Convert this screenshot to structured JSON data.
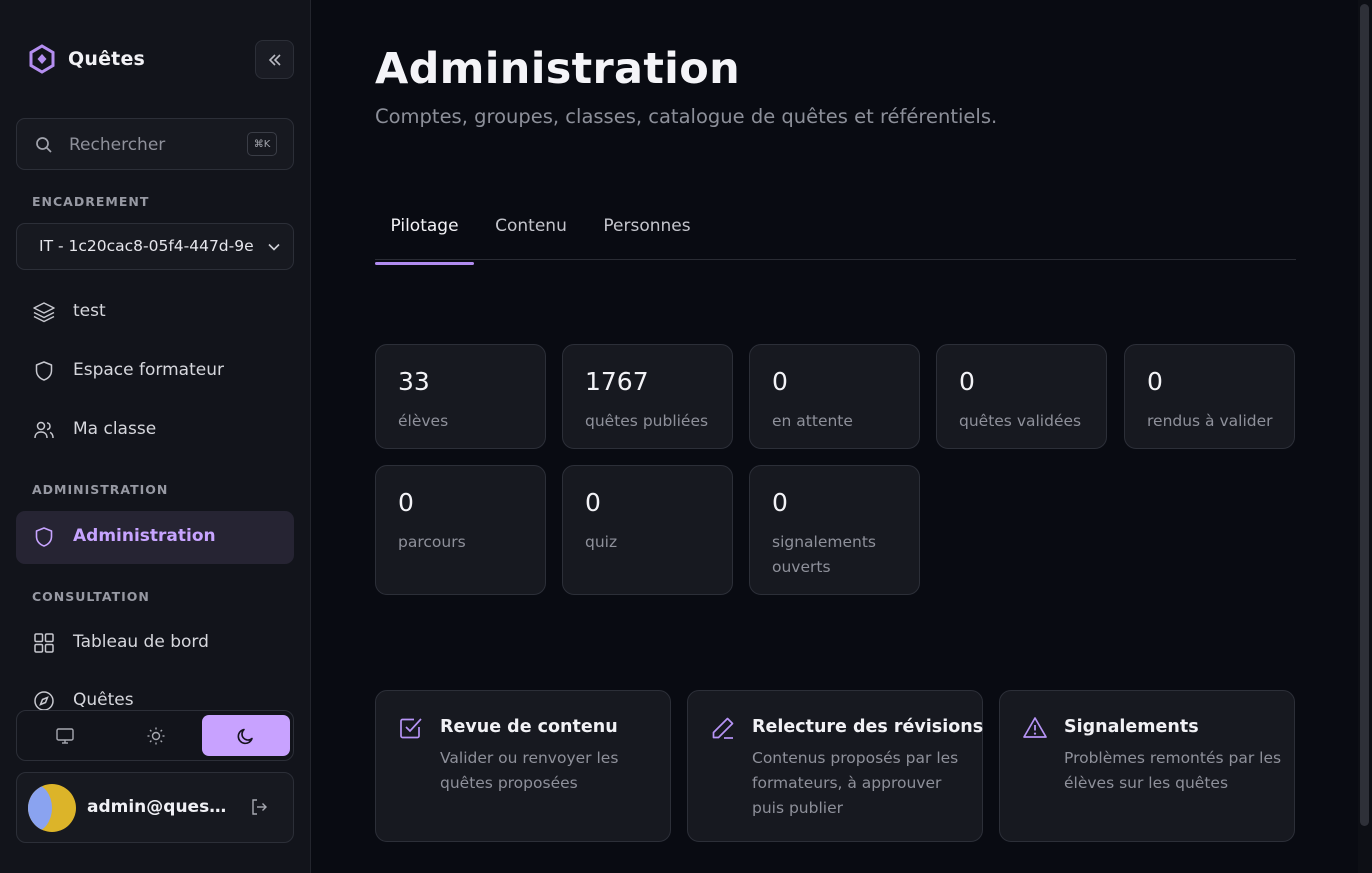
{
  "app": {
    "name": "Quêtes",
    "accent": "#c8a2ff"
  },
  "sidebar": {
    "search": {
      "placeholder": "Rechercher",
      "shortcut": "⌘K"
    },
    "sections": {
      "encadrement": "ENCADREMENT",
      "administration": "ADMINISTRATION",
      "consultation": "CONSULTATION"
    },
    "group_select": {
      "value": "IT - 1c20cac8-05f4-447d-9e"
    },
    "items": [
      {
        "label": "test",
        "icon": "layers-icon"
      },
      {
        "label": "Espace formateur",
        "icon": "shield-icon"
      },
      {
        "label": "Ma classe",
        "icon": "users-icon"
      },
      {
        "label": "Administration",
        "icon": "shield-icon",
        "active": true
      },
      {
        "label": "Tableau de bord",
        "icon": "grid-icon"
      },
      {
        "label": "Quêtes",
        "icon": "compass-icon"
      }
    ],
    "theme": {
      "options": [
        "system",
        "light",
        "dark"
      ],
      "selected": "dark"
    },
    "user": {
      "email": "admin@quest-..."
    }
  },
  "main": {
    "title": "Administration",
    "subtitle": "Comptes, groupes, classes, catalogue de quêtes et référentiels.",
    "tabs": [
      {
        "label": "Pilotage",
        "active": true
      },
      {
        "label": "Contenu"
      },
      {
        "label": "Personnes"
      }
    ],
    "stats": [
      {
        "value": "33",
        "label": "élèves"
      },
      {
        "value": "1767",
        "label": "quêtes publiées"
      },
      {
        "value": "0",
        "label": "en attente"
      },
      {
        "value": "0",
        "label": "quêtes validées"
      },
      {
        "value": "0",
        "label": "rendus à valider"
      },
      {
        "value": "0",
        "label": "parcours"
      },
      {
        "value": "0",
        "label": "quiz"
      },
      {
        "value": "0",
        "label": "signalements ouverts"
      }
    ],
    "actions": [
      {
        "title": "Revue de contenu",
        "description": "Valider ou renvoyer les quêtes proposées",
        "icon": "check-square-icon"
      },
      {
        "title": "Relecture des révisions",
        "description": "Contenus proposés par les formateurs, à approuver puis publier",
        "icon": "pencil-icon"
      },
      {
        "title": "Signalements",
        "description": "Problèmes remontés par les élèves sur les quêtes",
        "icon": "warning-triangle-icon"
      }
    ]
  }
}
